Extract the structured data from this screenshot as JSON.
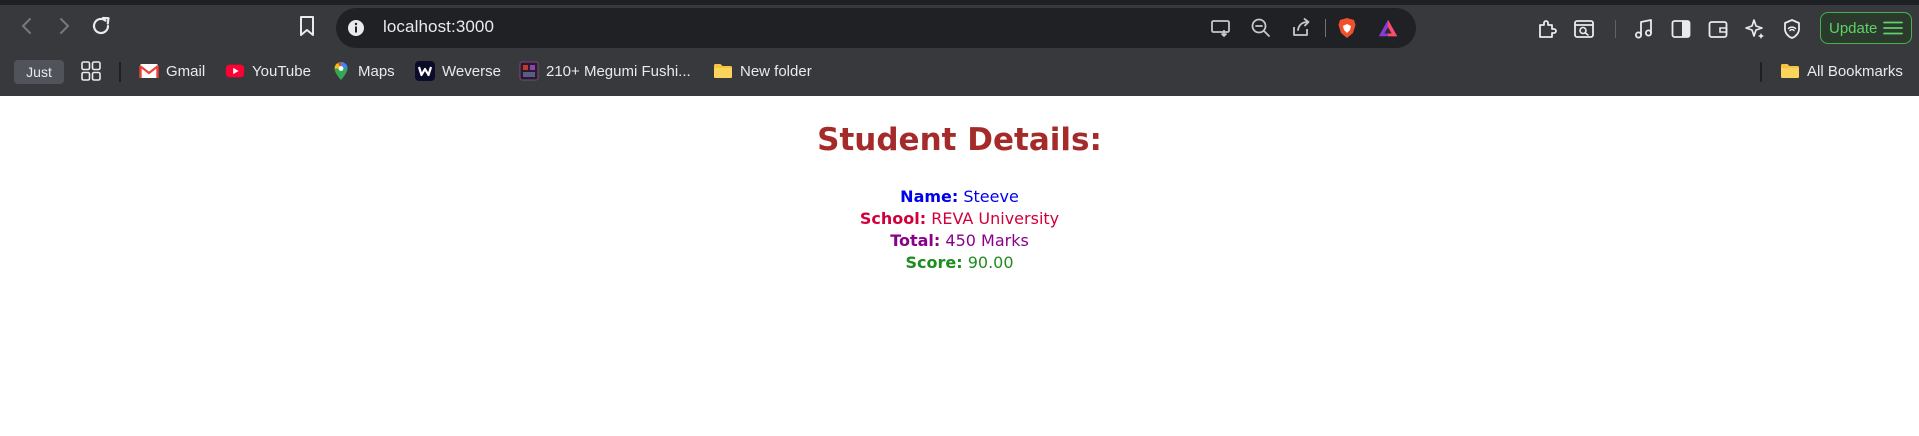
{
  "browser": {
    "url": "localhost:3000",
    "update_label": "Update",
    "bookmark_chip": "Just",
    "bookmarks": [
      {
        "label": "Gmail",
        "icon": "gmail-icon"
      },
      {
        "label": "YouTube",
        "icon": "youtube-icon"
      },
      {
        "label": "Maps",
        "icon": "maps-icon"
      },
      {
        "label": "Weverse",
        "icon": "weverse-icon"
      },
      {
        "label": "210+ Megumi Fushi...",
        "icon": "page-icon"
      },
      {
        "label": "New folder",
        "icon": "folder-icon"
      }
    ],
    "all_bookmarks": "All Bookmarks",
    "colors": {
      "frame": "#38393c",
      "omnibox": "#202124",
      "update_accent": "#47b14f"
    }
  },
  "page": {
    "title": "Student Details:",
    "fields": [
      {
        "label": "Name:",
        "value": "Steeve",
        "color": "#0000ee"
      },
      {
        "label": "School:",
        "value": "REVA University",
        "color": "#d2003a"
      },
      {
        "label": "Total:",
        "value": "450 Marks",
        "color": "#8b008b"
      },
      {
        "label": "Score:",
        "value": "90.00",
        "color": "#1e8c1e"
      }
    ],
    "title_color": "#a52a2a"
  }
}
